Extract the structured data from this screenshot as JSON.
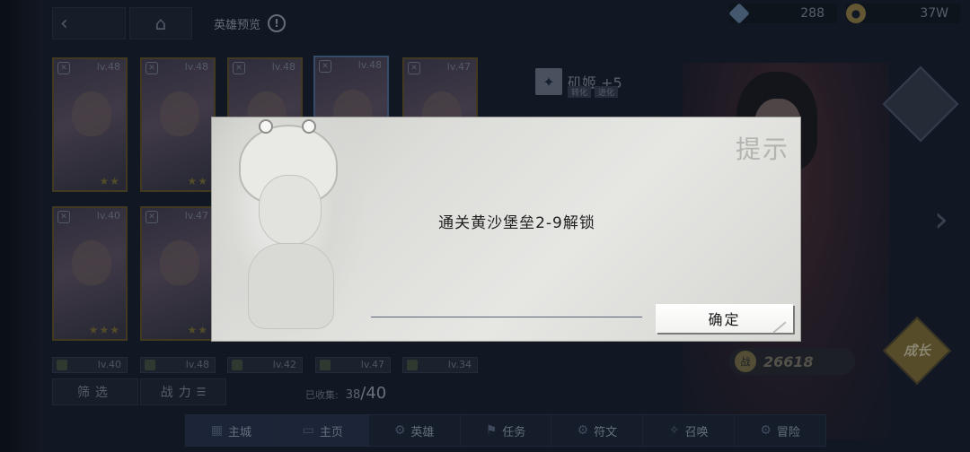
{
  "header": {
    "back_icon": "‹",
    "home_icon": "⌂",
    "title": "英雄预览",
    "info_icon": "!"
  },
  "currency": {
    "gems": "288",
    "gold": "37W"
  },
  "roster": {
    "cards": [
      {
        "level": "lv.48",
        "stars": "★★"
      },
      {
        "level": "lv.48",
        "stars": "★★"
      },
      {
        "level": "lv.48",
        "stars": "★★"
      },
      {
        "level": "lv.48",
        "stars": "★★"
      },
      {
        "level": "lv.47",
        "stars": "★★"
      },
      {
        "level": "lv.40",
        "stars": "★★★"
      },
      {
        "level": "lv.47",
        "stars": "★★"
      }
    ],
    "small_cards": [
      "lv.40",
      "lv.48",
      "lv.42",
      "lv.47",
      "lv.34"
    ],
    "filter_label": "筛选",
    "power_sort_label": "战力",
    "collected_label": "已收集:",
    "collected_count": "38",
    "collected_total": "/40"
  },
  "hero": {
    "name": "矶姬 +5",
    "tags": [
      "转化",
      "进化"
    ],
    "power": "26618",
    "grow_label": "成长"
  },
  "bottom_nav": [
    {
      "label": "主城",
      "icon": "castle-icon"
    },
    {
      "label": "主页",
      "icon": "home-icon"
    },
    {
      "label": "英雄",
      "icon": "hero-icon"
    },
    {
      "label": "任务",
      "icon": "task-icon"
    },
    {
      "label": "符文",
      "icon": "rune-icon"
    },
    {
      "label": "召唤",
      "icon": "summon-icon"
    },
    {
      "label": "冒险",
      "icon": "adventure-icon"
    }
  ],
  "dialog": {
    "title": "提示",
    "message": "通关黄沙堡垒2-9解锁",
    "confirm_label": "确定"
  }
}
